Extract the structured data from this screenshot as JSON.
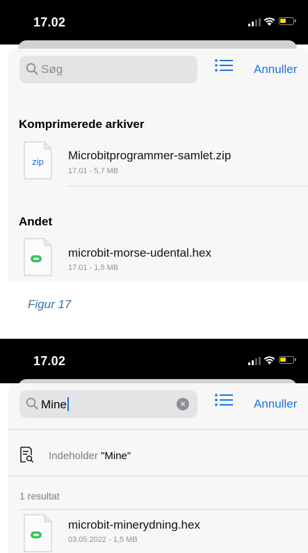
{
  "figure1": {
    "status": {
      "time": "17.02"
    },
    "search": {
      "placeholder": "Søg"
    },
    "cancel_label": "Annuller",
    "sections": [
      {
        "header": "Komprimerede arkiver",
        "files": [
          {
            "name": "Microbitprogrammer-samlet.zip",
            "meta": "17.01 - 5,7 MB",
            "icon_label": "zip",
            "icon": "zip-file-icon"
          }
        ]
      },
      {
        "header": "Andet",
        "files": [
          {
            "name": "microbit-morse-udental.hex",
            "meta": "17.01 - 1,5 MB",
            "icon": "hex-file-icon"
          }
        ]
      }
    ]
  },
  "caption": "Figur 17",
  "figure2": {
    "status": {
      "time": "17.02"
    },
    "search": {
      "value": "Mine"
    },
    "cancel_label": "Annuller",
    "contains": {
      "prefix": "Indeholder ",
      "query": "\"Mine\""
    },
    "results_count": "1 resultat",
    "files": [
      {
        "name": "microbit-minerydning.hex",
        "meta": "03.05.2022 - 1,5 MB",
        "icon": "hex-file-icon"
      }
    ]
  },
  "colors": {
    "accent": "#1a73e8",
    "battery": "#ffd60a",
    "hex_badge": "#34c759",
    "zip_label": "#1a73e8",
    "caption": "#3a6fa6"
  }
}
